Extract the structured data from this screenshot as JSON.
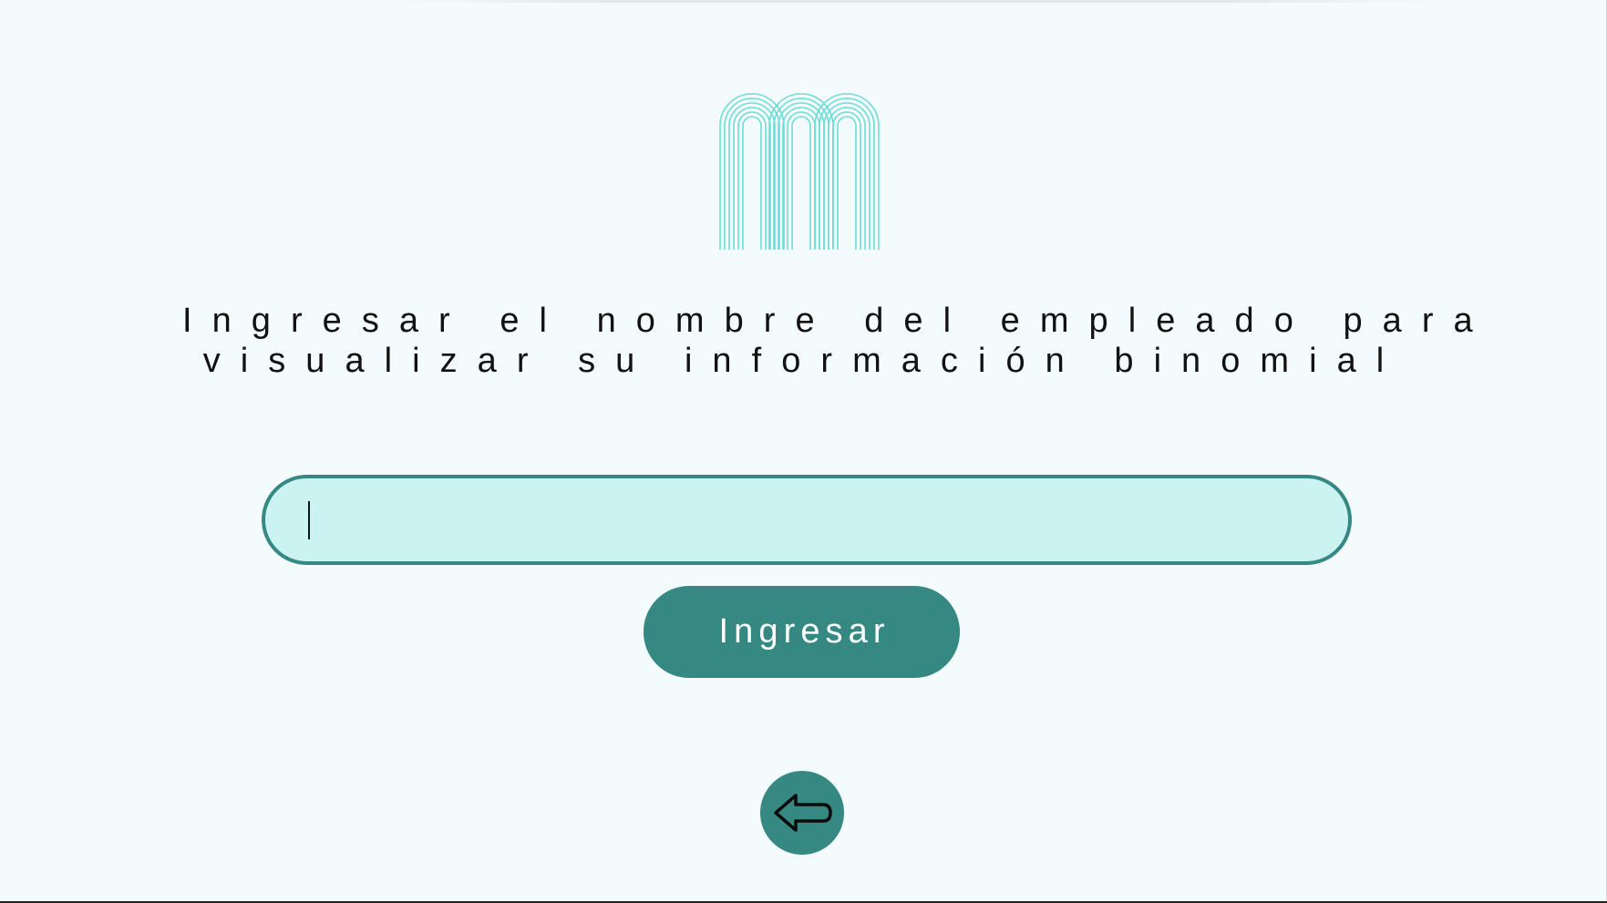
{
  "page": {
    "instruction_line1": "Ingresar el nombre del empleado para",
    "instruction_line2": "visualizar su información binomial"
  },
  "form": {
    "employee_name_value": "",
    "submit_label": "Ingresar"
  },
  "icons": {
    "logo": "striped-m-logo",
    "back": "arrow-left-icon"
  },
  "colors": {
    "background": "#f3fbfc",
    "accent": "#368882",
    "input_fill": "#cbf3f2",
    "logo": "#6fdcd6"
  }
}
